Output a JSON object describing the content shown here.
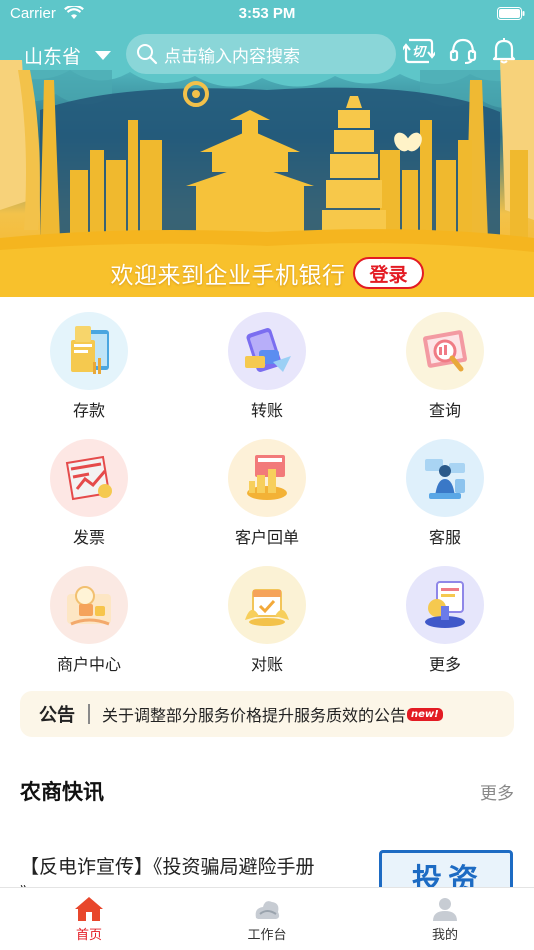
{
  "status_bar": {
    "carrier": "Carrier",
    "time": "3:53 PM"
  },
  "header": {
    "region": "山东省",
    "search_placeholder": "点击输入内容搜索",
    "icons": [
      "switch-icon",
      "headset-icon",
      "bell-icon"
    ]
  },
  "banner": {
    "welcome_text": "欢迎来到企业手机银行",
    "login_label": "登录"
  },
  "grid": {
    "items": [
      {
        "label": "存款",
        "icon": "deposit-icon"
      },
      {
        "label": "转账",
        "icon": "transfer-icon"
      },
      {
        "label": "查询",
        "icon": "query-icon"
      },
      {
        "label": "发票",
        "icon": "invoice-icon"
      },
      {
        "label": "客户回单",
        "icon": "receipt-icon"
      },
      {
        "label": "客服",
        "icon": "customer-service-icon"
      },
      {
        "label": "商户中心",
        "icon": "merchant-icon"
      },
      {
        "label": "对账",
        "icon": "reconcile-icon"
      },
      {
        "label": "更多",
        "icon": "more-icon"
      }
    ]
  },
  "notice": {
    "tag": "公告",
    "message": "关于调整部分服务价格提升服务质效的公告",
    "badge": "new!"
  },
  "news": {
    "title": "农商快讯",
    "more_label": "更多",
    "items": [
      {
        "headline": "【反电诈宣传】《投资骗局避险手册",
        "headline_cont": "》",
        "thumb_text": "投资"
      }
    ]
  },
  "tabbar": {
    "tabs": [
      {
        "label": "首页",
        "icon": "home-icon"
      },
      {
        "label": "工作台",
        "icon": "workbench-icon"
      },
      {
        "label": "我的",
        "icon": "profile-icon"
      }
    ]
  },
  "colors": {
    "brand_red": "#e31b23",
    "teal": "#4fb3bb",
    "gold": "#f6b31e"
  }
}
